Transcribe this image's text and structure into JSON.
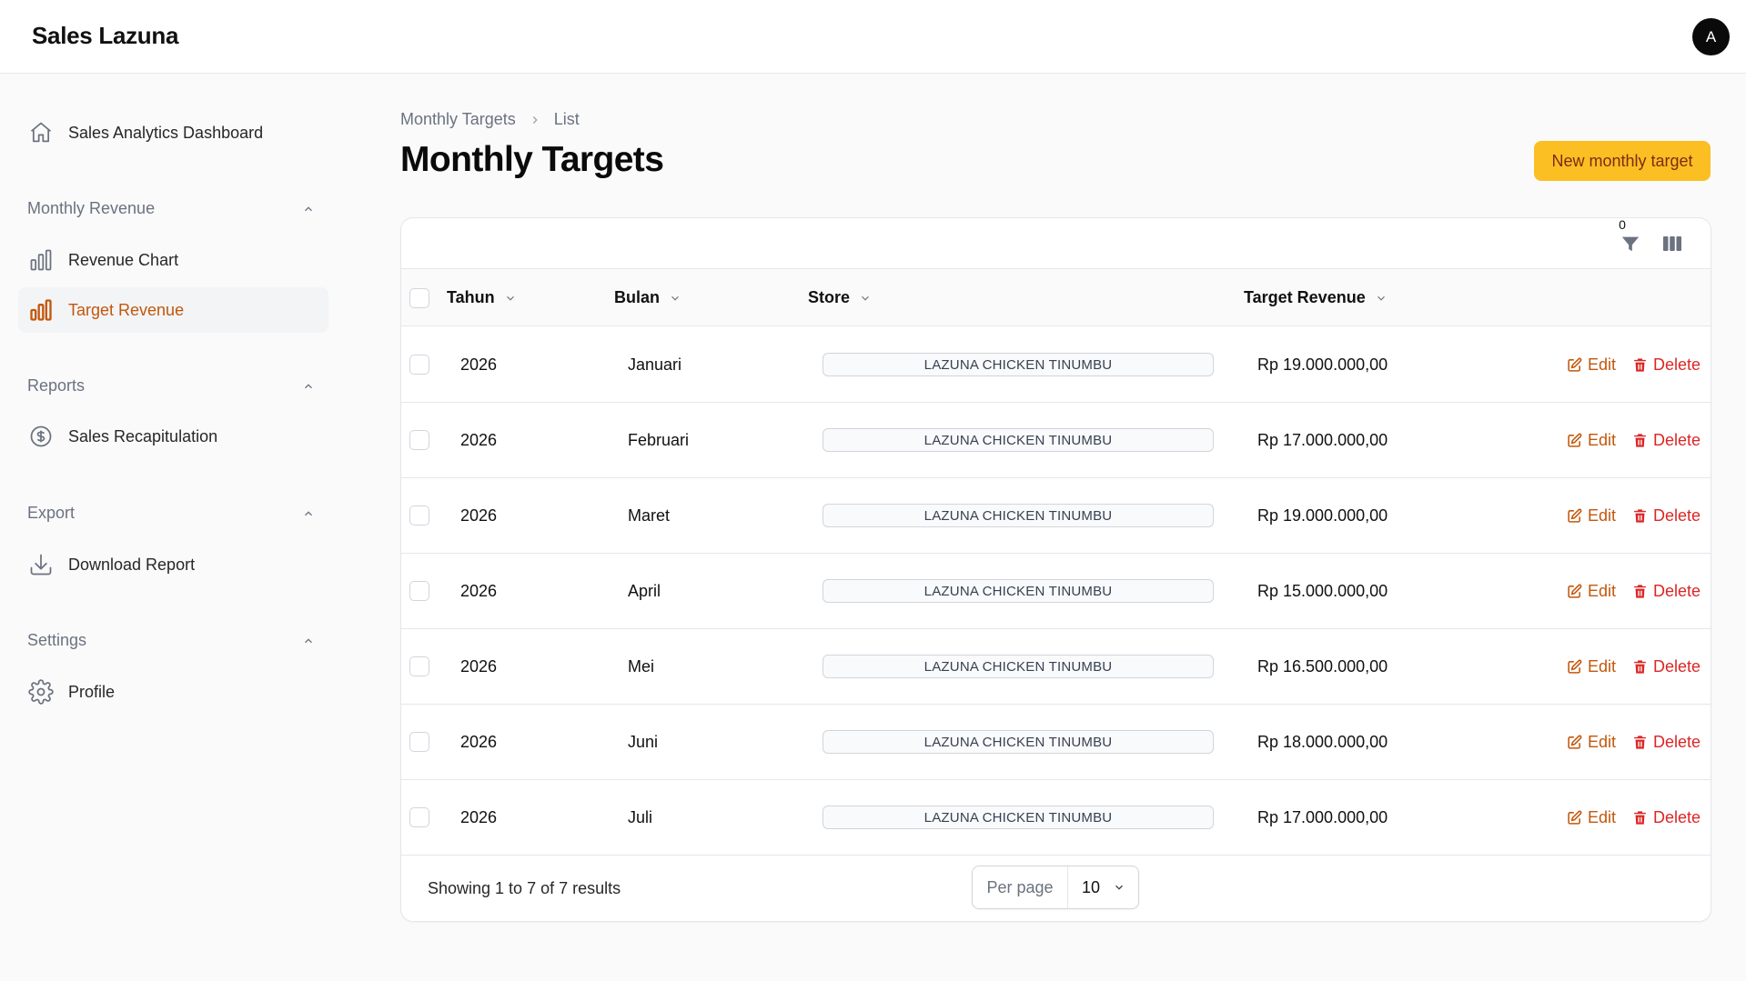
{
  "app": {
    "brand": "Sales Lazuna",
    "avatar_initial": "A"
  },
  "sidebar": {
    "dashboard": {
      "label": "Sales Analytics Dashboard",
      "icon": "home-icon"
    },
    "groups": [
      {
        "label": "Monthly Revenue",
        "items": [
          {
            "label": "Revenue Chart",
            "icon": "bar-chart-icon",
            "active": false
          },
          {
            "label": "Target Revenue",
            "icon": "bar-chart-icon",
            "active": true
          }
        ]
      },
      {
        "label": "Reports",
        "items": [
          {
            "label": "Sales Recapitulation",
            "icon": "dollar-circle-icon",
            "active": false
          }
        ]
      },
      {
        "label": "Export",
        "items": [
          {
            "label": "Download Report",
            "icon": "download-icon",
            "active": false
          }
        ]
      },
      {
        "label": "Settings",
        "items": [
          {
            "label": "Profile",
            "icon": "gear-icon",
            "active": false
          }
        ]
      }
    ]
  },
  "breadcrumb": {
    "parent": "Monthly Targets",
    "current": "List"
  },
  "page": {
    "title": "Monthly Targets",
    "new_button": "New monthly target"
  },
  "toolbar": {
    "filter_count": "0"
  },
  "table": {
    "columns": [
      "Tahun",
      "Bulan",
      "Store",
      "Target Revenue"
    ],
    "action_edit": "Edit",
    "action_delete": "Delete",
    "rows": [
      {
        "tahun": "2026",
        "bulan": "Januari",
        "store": "LAZUNA CHICKEN TINUMBU",
        "target": "Rp 19.000.000,00"
      },
      {
        "tahun": "2026",
        "bulan": "Februari",
        "store": "LAZUNA CHICKEN TINUMBU",
        "target": "Rp 17.000.000,00"
      },
      {
        "tahun": "2026",
        "bulan": "Maret",
        "store": "LAZUNA CHICKEN TINUMBU",
        "target": "Rp 19.000.000,00"
      },
      {
        "tahun": "2026",
        "bulan": "April",
        "store": "LAZUNA CHICKEN TINUMBU",
        "target": "Rp 15.000.000,00"
      },
      {
        "tahun": "2026",
        "bulan": "Mei",
        "store": "LAZUNA CHICKEN TINUMBU",
        "target": "Rp 16.500.000,00"
      },
      {
        "tahun": "2026",
        "bulan": "Juni",
        "store": "LAZUNA CHICKEN TINUMBU",
        "target": "Rp 18.000.000,00"
      },
      {
        "tahun": "2026",
        "bulan": "Juli",
        "store": "LAZUNA CHICKEN TINUMBU",
        "target": "Rp 17.000.000,00"
      }
    ]
  },
  "footer": {
    "showing": "Showing 1 to 7 of 7 results",
    "per_page_label": "Per page",
    "per_page_value": "10"
  },
  "colors": {
    "accent": "#fbbf24",
    "accent_text": "#c2570c",
    "danger": "#dc2626"
  }
}
